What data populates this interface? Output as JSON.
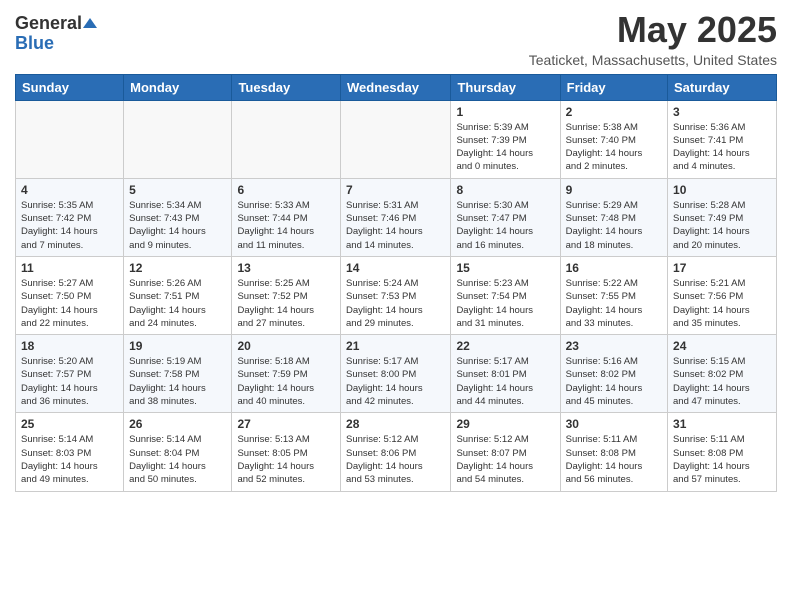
{
  "logo": {
    "general": "General",
    "blue": "Blue"
  },
  "title": "May 2025",
  "subtitle": "Teaticket, Massachusetts, United States",
  "weekdays": [
    "Sunday",
    "Monday",
    "Tuesday",
    "Wednesday",
    "Thursday",
    "Friday",
    "Saturday"
  ],
  "weeks": [
    [
      {
        "day": "",
        "info": ""
      },
      {
        "day": "",
        "info": ""
      },
      {
        "day": "",
        "info": ""
      },
      {
        "day": "",
        "info": ""
      },
      {
        "day": "1",
        "info": "Sunrise: 5:39 AM\nSunset: 7:39 PM\nDaylight: 14 hours\nand 0 minutes."
      },
      {
        "day": "2",
        "info": "Sunrise: 5:38 AM\nSunset: 7:40 PM\nDaylight: 14 hours\nand 2 minutes."
      },
      {
        "day": "3",
        "info": "Sunrise: 5:36 AM\nSunset: 7:41 PM\nDaylight: 14 hours\nand 4 minutes."
      }
    ],
    [
      {
        "day": "4",
        "info": "Sunrise: 5:35 AM\nSunset: 7:42 PM\nDaylight: 14 hours\nand 7 minutes."
      },
      {
        "day": "5",
        "info": "Sunrise: 5:34 AM\nSunset: 7:43 PM\nDaylight: 14 hours\nand 9 minutes."
      },
      {
        "day": "6",
        "info": "Sunrise: 5:33 AM\nSunset: 7:44 PM\nDaylight: 14 hours\nand 11 minutes."
      },
      {
        "day": "7",
        "info": "Sunrise: 5:31 AM\nSunset: 7:46 PM\nDaylight: 14 hours\nand 14 minutes."
      },
      {
        "day": "8",
        "info": "Sunrise: 5:30 AM\nSunset: 7:47 PM\nDaylight: 14 hours\nand 16 minutes."
      },
      {
        "day": "9",
        "info": "Sunrise: 5:29 AM\nSunset: 7:48 PM\nDaylight: 14 hours\nand 18 minutes."
      },
      {
        "day": "10",
        "info": "Sunrise: 5:28 AM\nSunset: 7:49 PM\nDaylight: 14 hours\nand 20 minutes."
      }
    ],
    [
      {
        "day": "11",
        "info": "Sunrise: 5:27 AM\nSunset: 7:50 PM\nDaylight: 14 hours\nand 22 minutes."
      },
      {
        "day": "12",
        "info": "Sunrise: 5:26 AM\nSunset: 7:51 PM\nDaylight: 14 hours\nand 24 minutes."
      },
      {
        "day": "13",
        "info": "Sunrise: 5:25 AM\nSunset: 7:52 PM\nDaylight: 14 hours\nand 27 minutes."
      },
      {
        "day": "14",
        "info": "Sunrise: 5:24 AM\nSunset: 7:53 PM\nDaylight: 14 hours\nand 29 minutes."
      },
      {
        "day": "15",
        "info": "Sunrise: 5:23 AM\nSunset: 7:54 PM\nDaylight: 14 hours\nand 31 minutes."
      },
      {
        "day": "16",
        "info": "Sunrise: 5:22 AM\nSunset: 7:55 PM\nDaylight: 14 hours\nand 33 minutes."
      },
      {
        "day": "17",
        "info": "Sunrise: 5:21 AM\nSunset: 7:56 PM\nDaylight: 14 hours\nand 35 minutes."
      }
    ],
    [
      {
        "day": "18",
        "info": "Sunrise: 5:20 AM\nSunset: 7:57 PM\nDaylight: 14 hours\nand 36 minutes."
      },
      {
        "day": "19",
        "info": "Sunrise: 5:19 AM\nSunset: 7:58 PM\nDaylight: 14 hours\nand 38 minutes."
      },
      {
        "day": "20",
        "info": "Sunrise: 5:18 AM\nSunset: 7:59 PM\nDaylight: 14 hours\nand 40 minutes."
      },
      {
        "day": "21",
        "info": "Sunrise: 5:17 AM\nSunset: 8:00 PM\nDaylight: 14 hours\nand 42 minutes."
      },
      {
        "day": "22",
        "info": "Sunrise: 5:17 AM\nSunset: 8:01 PM\nDaylight: 14 hours\nand 44 minutes."
      },
      {
        "day": "23",
        "info": "Sunrise: 5:16 AM\nSunset: 8:02 PM\nDaylight: 14 hours\nand 45 minutes."
      },
      {
        "day": "24",
        "info": "Sunrise: 5:15 AM\nSunset: 8:02 PM\nDaylight: 14 hours\nand 47 minutes."
      }
    ],
    [
      {
        "day": "25",
        "info": "Sunrise: 5:14 AM\nSunset: 8:03 PM\nDaylight: 14 hours\nand 49 minutes."
      },
      {
        "day": "26",
        "info": "Sunrise: 5:14 AM\nSunset: 8:04 PM\nDaylight: 14 hours\nand 50 minutes."
      },
      {
        "day": "27",
        "info": "Sunrise: 5:13 AM\nSunset: 8:05 PM\nDaylight: 14 hours\nand 52 minutes."
      },
      {
        "day": "28",
        "info": "Sunrise: 5:12 AM\nSunset: 8:06 PM\nDaylight: 14 hours\nand 53 minutes."
      },
      {
        "day": "29",
        "info": "Sunrise: 5:12 AM\nSunset: 8:07 PM\nDaylight: 14 hours\nand 54 minutes."
      },
      {
        "day": "30",
        "info": "Sunrise: 5:11 AM\nSunset: 8:08 PM\nDaylight: 14 hours\nand 56 minutes."
      },
      {
        "day": "31",
        "info": "Sunrise: 5:11 AM\nSunset: 8:08 PM\nDaylight: 14 hours\nand 57 minutes."
      }
    ]
  ]
}
